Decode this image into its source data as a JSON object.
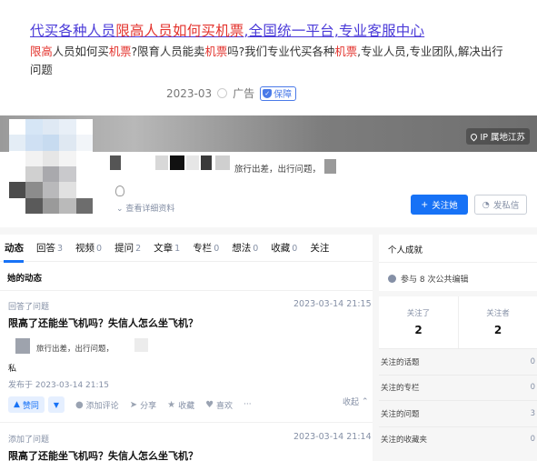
{
  "ad": {
    "title_parts": [
      "代买各种人员",
      "限高人员如何买机票",
      ",全国统一平台,专业客服中心"
    ],
    "desc_parts": [
      "限高",
      "人员如何买",
      "机票",
      "?限育人员能卖",
      "机票",
      "吗?我们专业代买各种",
      "机票",
      ",专业人员,专业团队,解决出行问题"
    ],
    "date": "2023-03",
    "ad_label": "广告",
    "badge": "保障"
  },
  "profile": {
    "ip_location": "IP 属地江苏",
    "bio": "旅行出差，出行问题，",
    "detail_link": "查看详细资料",
    "follow_button": "关注她",
    "message_button": "发私信"
  },
  "tabs": [
    {
      "label": "动态",
      "count": ""
    },
    {
      "label": "回答",
      "count": "3"
    },
    {
      "label": "视频",
      "count": "0"
    },
    {
      "label": "提问",
      "count": "2"
    },
    {
      "label": "文章",
      "count": "1"
    },
    {
      "label": "专栏",
      "count": "0"
    },
    {
      "label": "想法",
      "count": "0"
    },
    {
      "label": "收藏",
      "count": "0"
    },
    {
      "label": "关注",
      "count": ""
    }
  ],
  "feed": {
    "section_title": "她的动态",
    "items": [
      {
        "label": "回答了问题",
        "time": "2023-03-14 21:15",
        "title": "限高了还能坐飞机吗？失信人怎么坐飞机？",
        "author_bio": "旅行出差，出行问题，",
        "excerpt": "私",
        "published": "发布于 2023-03-14 21:15"
      },
      {
        "label": "添加了问题",
        "time": "2023-03-14 21:14",
        "title": "限高了还能坐飞机吗？失信人怎么坐飞机？"
      }
    ],
    "actions": {
      "upvote": "赞同",
      "comment": "添加评论",
      "share": "分享",
      "favorite": "收藏",
      "like": "喜欢",
      "more": "···",
      "collapse": "收起"
    }
  },
  "sidebar": {
    "achievements_title": "个人成就",
    "edit_stat": "参与 8 次公共编辑",
    "following_label": "关注了",
    "following_count": "2",
    "followers_label": "关注者",
    "followers_count": "2",
    "rows": [
      {
        "label": "关注的话题",
        "value": "0"
      },
      {
        "label": "关注的专栏",
        "value": "0"
      },
      {
        "label": "关注的问题",
        "value": "3"
      },
      {
        "label": "关注的收藏夹",
        "value": "0"
      }
    ]
  },
  "colors": {
    "accent": "#1772f6",
    "ad_link": "#4a3ad8",
    "ad_highlight": "#e3322c"
  }
}
